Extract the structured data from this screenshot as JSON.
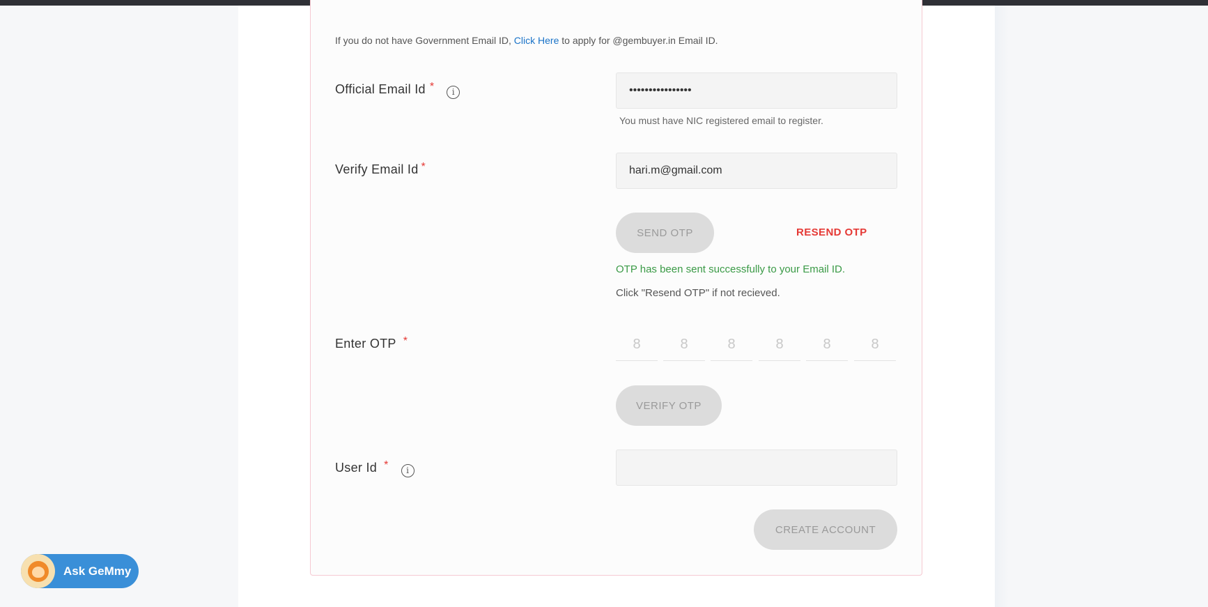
{
  "intro": {
    "before": "If you do not have Government Email ID, ",
    "link": "Click Here",
    "after": " to apply for @gembuyer.in Email ID."
  },
  "official_email": {
    "label": "Official Email Id",
    "required": "*",
    "info": "i",
    "value": "••••••••••••••••",
    "hint": "You must have NIC registered email to register."
  },
  "verify_email": {
    "label": "Verify Email Id",
    "required": "*",
    "value": "hari.m@gmail.com"
  },
  "otp_actions": {
    "send_label": "SEND OTP",
    "resend_label": "RESEND OTP",
    "success_message": "OTP has been sent successfully to your Email ID.",
    "resend_note": "Click \"Resend OTP\" if not recieved."
  },
  "enter_otp": {
    "label": "Enter OTP",
    "required": "*",
    "placeholders": [
      "8",
      "8",
      "8",
      "8",
      "8",
      "8"
    ],
    "verify_label": "VERIFY OTP"
  },
  "user_id": {
    "label": "User Id",
    "required": "*",
    "info": "i",
    "value": ""
  },
  "create_account_label": "CREATE ACCOUNT",
  "assistant": {
    "label": "Ask GeMmy"
  }
}
